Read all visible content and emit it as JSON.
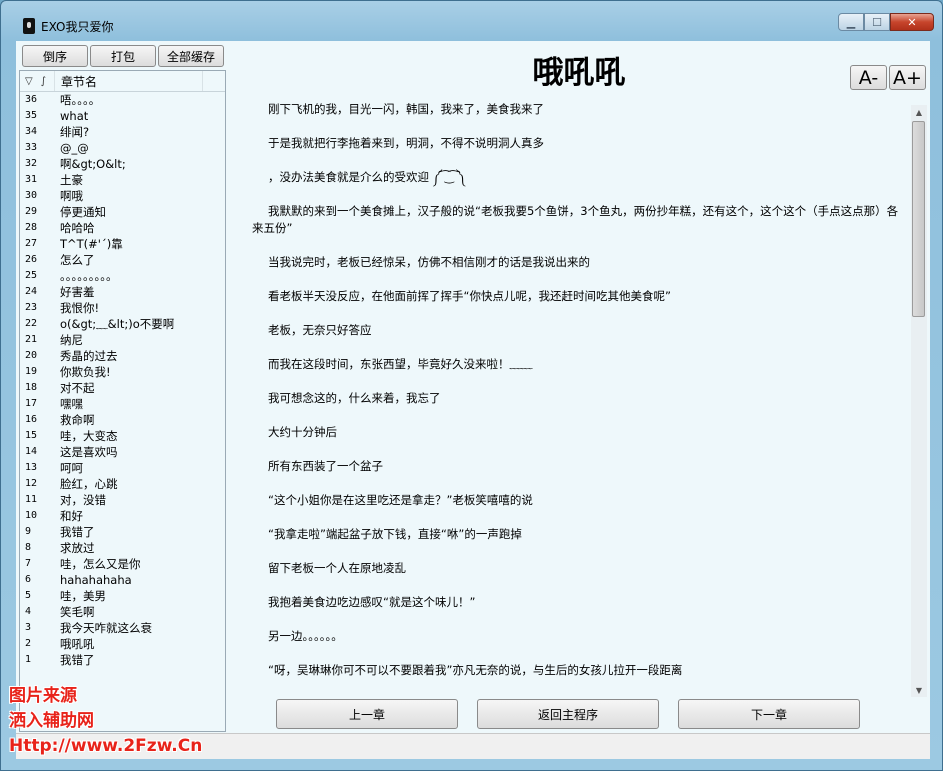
{
  "window": {
    "title": "EXO我只爱你",
    "controls": {
      "minimize": "▁",
      "maximize": "☐",
      "close": "✕"
    }
  },
  "toolbar": {
    "sort_label": "倒序",
    "pack_label": "打包",
    "cache_all_label": "全部缓存"
  },
  "chapter_list": {
    "header_sort_icon": "▽",
    "header_divider": "∫",
    "header_name": "章节名",
    "rows": [
      {
        "idx": "36",
        "name": "唔。。。。"
      },
      {
        "idx": "35",
        "name": "what"
      },
      {
        "idx": "34",
        "name": "绯闻?"
      },
      {
        "idx": "33",
        "name": "@_@"
      },
      {
        "idx": "32",
        "name": "啊&gt;O&lt;"
      },
      {
        "idx": "31",
        "name": "土豪"
      },
      {
        "idx": "30",
        "name": "啊哦"
      },
      {
        "idx": "29",
        "name": "停更通知"
      },
      {
        "idx": "28",
        "name": "哈哈哈"
      },
      {
        "idx": "27",
        "name": "T^T(#'ˊ)靠"
      },
      {
        "idx": "26",
        "name": "怎么了"
      },
      {
        "idx": "25",
        "name": "。。。。。。。。。"
      },
      {
        "idx": "24",
        "name": "好害羞"
      },
      {
        "idx": "23",
        "name": "我恨你!"
      },
      {
        "idx": "22",
        "name": "o(&gt;﹏&lt;)o不要啊"
      },
      {
        "idx": "21",
        "name": "纳尼"
      },
      {
        "idx": "20",
        "name": "秀晶的过去"
      },
      {
        "idx": "19",
        "name": "你欺负我!"
      },
      {
        "idx": "18",
        "name": "对不起"
      },
      {
        "idx": "17",
        "name": "嘿嘿"
      },
      {
        "idx": "16",
        "name": "救命啊"
      },
      {
        "idx": "15",
        "name": "哇，大变态"
      },
      {
        "idx": "14",
        "name": "这是喜欢吗"
      },
      {
        "idx": "13",
        "name": "呵呵"
      },
      {
        "idx": "12",
        "name": "脸红，心跳"
      },
      {
        "idx": "11",
        "name": "对，没错"
      },
      {
        "idx": "10",
        "name": "和好"
      },
      {
        "idx": "9",
        "name": "我错了"
      },
      {
        "idx": "8",
        "name": "求放过"
      },
      {
        "idx": "7",
        "name": "哇，怎么又是你"
      },
      {
        "idx": "6",
        "name": "hahahahaha"
      },
      {
        "idx": "5",
        "name": "哇，美男"
      },
      {
        "idx": "4",
        "name": "笑毛啊"
      },
      {
        "idx": "3",
        "name": "我今天咋就这么衰"
      },
      {
        "idx": "2",
        "name": "哦吼吼"
      },
      {
        "idx": "1",
        "name": "我错了"
      }
    ]
  },
  "reader": {
    "chapter_title": "哦吼吼",
    "font_smaller": "A-",
    "font_larger": "A+",
    "paragraphs": [
      "刚下飞机的我，目光一闪，韩国，我来了，美食我来了",
      "于是我就把行李拖着来到，明洞，不得不说明洞人真多",
      "，没办法美食就是介么的受欢迎 ༼ ͡ ͜ ͡ ༽",
      "我默默的来到一个美食摊上，汉子般的说“老板我要5个鱼饼，3个鱼丸，两份抄年糕，还有这个，这个这个（手点这点那）各来五份”",
      "当我说完时，老板已经惊呆，仿佛不相信刚才的话是我说出来的",
      "看老板半天没反应，在他面前挥了挥手“你快点儿呢，我还赶时间吃其他美食呢”",
      "老板，无奈只好答应",
      "而我在这段时间，东张西望，毕竟好久没来啦！﹏﹏",
      "我可想念这的，什么来着，我忘了",
      "大约十分钟后",
      "所有东西装了一个盆子",
      "“这个小姐你是在这里吃还是拿走？”老板笑嘻嘻的说",
      "“我拿走啦”端起盆子放下钱，直接“咻”的一声跑掉",
      "留下老板一个人在原地凌乱",
      "我抱着美食边吃边感叹“就是这个味儿！”",
      "另一边。。。。。。",
      "“呀，吴琳琳你可不可以不要跟着我”亦凡无奈的说，与生后的女孩儿拉开一段距离"
    ]
  },
  "nav": {
    "prev_label": "上一章",
    "home_label": "返回主程序",
    "next_label": "下一章"
  },
  "scrollbar": {
    "up_icon": "▲",
    "down_icon": "▼"
  },
  "watermark": {
    "line1": "图片来源",
    "line2": "洒入辅助网",
    "line3": "Http://www.2Fzw.Cn"
  }
}
